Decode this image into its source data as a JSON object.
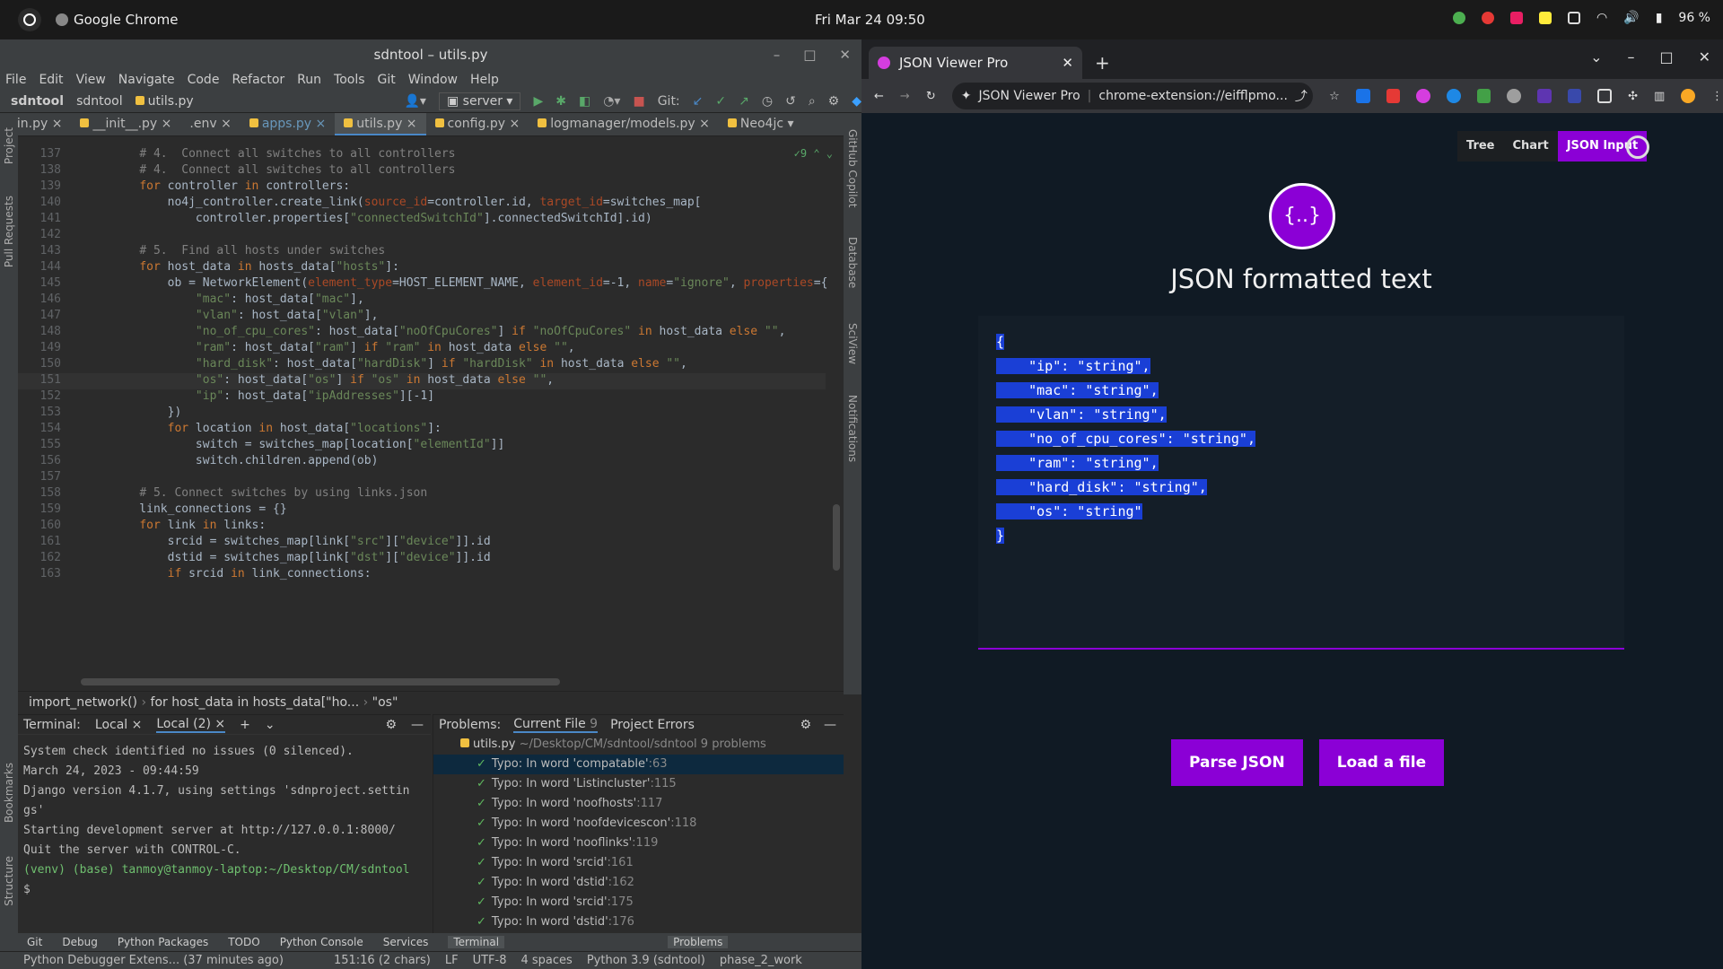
{
  "topbar": {
    "app": "Google Chrome",
    "datetime": "Fri Mar 24  09:50",
    "battery": "96 %"
  },
  "ide": {
    "title": "sdntool – utils.py",
    "menu": [
      "File",
      "Edit",
      "View",
      "Navigate",
      "Code",
      "Refactor",
      "Run",
      "Tools",
      "Git",
      "Window",
      "Help"
    ],
    "breadcrumb": [
      "sdntool",
      "sdntool",
      "utils.py"
    ],
    "run_config": "server",
    "git_label": "Git:",
    "tabs": [
      "nin.py",
      "__init__.py",
      ".env",
      "apps.py",
      "utils.py",
      "config.py",
      "logmanager/models.py",
      "Neo4jc"
    ],
    "active_tab": "utils.py",
    "inspections": "9",
    "left_tools": [
      "Project",
      "Pull Requests",
      "Bookmarks",
      "Structure"
    ],
    "right_tools": [
      "GitHub Copilot",
      "Database",
      "SciView",
      "Notifications"
    ],
    "code_lines": [
      {
        "n": "137",
        "html": "    <span class=\"cm\"># 4.  Connect all switches to all controllers</span>"
      },
      {
        "n": "138",
        "html": "    <span class=\"cm\"># 4.  Connect all switches to all controllers</span>"
      },
      {
        "n": "139",
        "html": "    <span class=\"kw\">for</span> controller <span class=\"kw\">in</span> controllers:"
      },
      {
        "n": "140",
        "html": "        no4j_controller.create_link(<span class=\"par\">source_id</span>=controller.id, <span class=\"par\">target_id</span>=switches_map["
      },
      {
        "n": "141",
        "html": "            controller.properties[<span class=\"str\">\"connectedSwitchId\"</span>].connectedSwitchId].id)"
      },
      {
        "n": "142",
        "html": ""
      },
      {
        "n": "143",
        "html": "    <span class=\"cm\"># 5.  Find all hosts under switches</span>"
      },
      {
        "n": "144",
        "html": "    <span class=\"kw\">for</span> host_data <span class=\"kw\">in</span> hosts_data[<span class=\"str\">\"hosts\"</span>]:"
      },
      {
        "n": "145",
        "html": "        ob = NetworkElement(<span class=\"par\">element_type</span>=HOST_ELEMENT_NAME, <span class=\"par\">element_id</span>=-1, <span class=\"par\">name</span>=<span class=\"str\">\"ignore\"</span>, <span class=\"par\">properties</span>={"
      },
      {
        "n": "146",
        "html": "            <span class=\"str\">\"mac\"</span>: host_data[<span class=\"str\">\"mac\"</span>],"
      },
      {
        "n": "147",
        "html": "            <span class=\"str\">\"vlan\"</span>: host_data[<span class=\"str\">\"vlan\"</span>],"
      },
      {
        "n": "148",
        "html": "            <span class=\"str\">\"no_of_cpu_cores\"</span>: host_data[<span class=\"str\">\"noOfCpuCores\"</span>] <span class=\"kw\">if</span> <span class=\"str\">\"noOfCpuCores\"</span> <span class=\"kw\">in</span> host_data <span class=\"kw\">else</span> <span class=\"str\">\"\"</span>,"
      },
      {
        "n": "149",
        "html": "            <span class=\"str\">\"ram\"</span>: host_data[<span class=\"str\">\"ram\"</span>] <span class=\"kw\">if</span> <span class=\"str\">\"ram\"</span> <span class=\"kw\">in</span> host_data <span class=\"kw\">else</span> <span class=\"str\">\"\"</span>,"
      },
      {
        "n": "150",
        "html": "            <span class=\"str\">\"hard_disk\"</span>: host_data[<span class=\"str\">\"hardDisk\"</span>] <span class=\"kw\">if</span> <span class=\"str\">\"hardDisk\"</span> <span class=\"kw\">in</span> host_data <span class=\"kw\">else</span> <span class=\"str\">\"\"</span>,"
      },
      {
        "n": "151",
        "html": "            <span class=\"str\">\"os\"</span>: host_data[<span class=\"str\">\"os\"</span>] <span class=\"kw\">if</span> <span class=\"str\">\"os\"</span> <span class=\"kw\">in</span> host_data <span class=\"kw\">else</span> <span class=\"str\">\"\"</span>,"
      },
      {
        "n": "152",
        "html": "            <span class=\"str\">\"ip\"</span>: host_data[<span class=\"str\">\"ipAddresses\"</span>][-1]"
      },
      {
        "n": "153",
        "html": "        })"
      },
      {
        "n": "154",
        "html": "        <span class=\"kw\">for</span> location <span class=\"kw\">in</span> host_data[<span class=\"str\">\"locations\"</span>]:"
      },
      {
        "n": "155",
        "html": "            switch = switches_map[location[<span class=\"str\">\"elementId\"</span>]]"
      },
      {
        "n": "156",
        "html": "            switch.children.append(ob)"
      },
      {
        "n": "157",
        "html": ""
      },
      {
        "n": "158",
        "html": "    <span class=\"cm\"># 5. Connect switches by using links.json</span>"
      },
      {
        "n": "159",
        "html": "    link_connections = {}"
      },
      {
        "n": "160",
        "html": "    <span class=\"kw\">for</span> link <span class=\"kw\">in</span> links:"
      },
      {
        "n": "161",
        "html": "        srcid = switches_map[link[<span class=\"str\">\"src\"</span>][<span class=\"str\">\"device\"</span>]].id"
      },
      {
        "n": "162",
        "html": "        dstid = switches_map[link[<span class=\"str\">\"dst\"</span>][<span class=\"str\">\"device\"</span>]].id"
      },
      {
        "n": "163",
        "html": "        <span class=\"kw\">if</span> srcid <span class=\"kw\">in</span> link_connections:"
      }
    ],
    "code_breadcrumb": [
      "import_network()",
      "for host_data in hosts_data[\"ho...",
      "\"os\""
    ],
    "terminal": {
      "label": "Terminal:",
      "tabs": [
        "Local",
        "Local (2)"
      ],
      "lines": [
        "System check identified no issues (0 silenced).",
        "March 24, 2023 - 09:44:59",
        "Django version 4.1.7, using settings 'sdnproject.settin",
        "gs'",
        "Starting development server at http://127.0.0.1:8000/",
        "Quit the server with CONTROL-C.",
        "(venv) (base) tanmoy@tanmoy-laptop:~/Desktop/CM/sdntool",
        "$ "
      ]
    },
    "problems": {
      "label": "Problems:",
      "tabs": [
        "Current File",
        "Project Errors"
      ],
      "current_file_count": "9",
      "file": "utils.py",
      "path": "~/Desktop/CM/sdntool/sdntool",
      "count": "9 problems",
      "items": [
        {
          "text": "Typo: In word 'compatable'",
          "line": ":63"
        },
        {
          "text": "Typo: In word 'Listincluster'",
          "line": ":115"
        },
        {
          "text": "Typo: In word 'noofhosts'",
          "line": ":117"
        },
        {
          "text": "Typo: In word 'noofdevicescon'",
          "line": ":118"
        },
        {
          "text": "Typo: In word 'nooflinks'",
          "line": ":119"
        },
        {
          "text": "Typo: In word 'srcid'",
          "line": ":161"
        },
        {
          "text": "Typo: In word 'dstid'",
          "line": ":162"
        },
        {
          "text": "Typo: In word 'srcid'",
          "line": ":175"
        },
        {
          "text": "Typo: In word 'dstid'",
          "line": ":176"
        }
      ]
    },
    "toolwindows": [
      "Git",
      "Debug",
      "Python Packages",
      "TODO",
      "Python Console",
      "Services",
      "Terminal",
      "Problems"
    ],
    "status": {
      "message": "Python Debugger Extens... (37 minutes ago)",
      "position": "151:16 (2 chars)",
      "line_sep": "LF",
      "encoding": "UTF-8",
      "indent": "4 spaces",
      "interpreter": "Python 3.9 (sdntool)",
      "branch": "phase_2_work"
    }
  },
  "chrome": {
    "tab_title": "JSON Viewer Pro",
    "omnibox_site": "JSON Viewer Pro",
    "omnibox_url": "chrome-extension://eifflpmo...",
    "page": {
      "tabs": [
        "Tree",
        "Chart",
        "JSON Input"
      ],
      "active": "JSON Input",
      "logo": "{..}",
      "title": "JSON formatted text",
      "json_lines": [
        "{",
        "    \"ip\": \"string\",",
        "    \"mac\": \"string\",",
        "    \"vlan\": \"string\",",
        "    \"no_of_cpu_cores\": \"string\",",
        "    \"ram\": \"string\",",
        "    \"hard_disk\": \"string\",",
        "    \"os\": \"string\"",
        "}"
      ],
      "parse_button": "Parse JSON",
      "load_button": "Load a file"
    },
    "accent": "#8b00d6"
  }
}
